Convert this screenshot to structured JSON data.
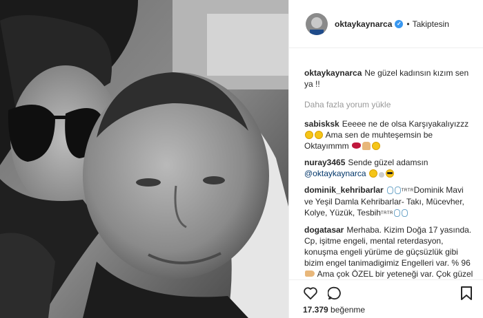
{
  "header": {
    "username": "oktaykaynarca",
    "verified_icon": "verified-badge-icon",
    "separator": "•",
    "follow_status": "Takiptesin"
  },
  "caption": {
    "username": "oktaykaynarca",
    "text": "Ne güzel kadınsın kızım sen ya !!"
  },
  "load_more": "Daha fazla yorum yükle",
  "comments": [
    {
      "username": "sabisksk",
      "text_1": "Eeeee ne de olsa Karşıyakalıyızzz",
      "text_2": "Ama sen de muhteşemsin be Oktayımmm"
    },
    {
      "username": "nuray3465",
      "text_1": "Sende güzel adamsın",
      "mention": "@oktaykaynarca"
    },
    {
      "username": "dominik_kehribarlar",
      "tm_1": "TRTR",
      "text_1": "Dominik Mavi ve Yeşil Damla Kehribarlar- Takı, Mücevher, Kolye, Yüzük, Tesbih",
      "tm_2": "TRTR"
    },
    {
      "username": "dogatasar",
      "text_1": "Merhaba. Kizim Doğa 17 yasında. Cp, işitme engeli, mental reterdasyon, konuşma engeli yürüme de güçsüzlük gibi bizim engel tanimadigimiz Engelleri var. % 96",
      "text_2": "Ama çok ÖZEL bir yeteneği var. Çok güzel RESİMLER yapıyor. Ben de O'nun bu yeteginin daha da gelişmesini istiyorum. Farlı edilmesini"
    }
  ],
  "actions": {
    "like_icon": "heart-icon",
    "comment_icon": "comment-icon",
    "save_icon": "bookmark-icon"
  },
  "likes": {
    "count": "17.379",
    "label": "beğenme"
  }
}
